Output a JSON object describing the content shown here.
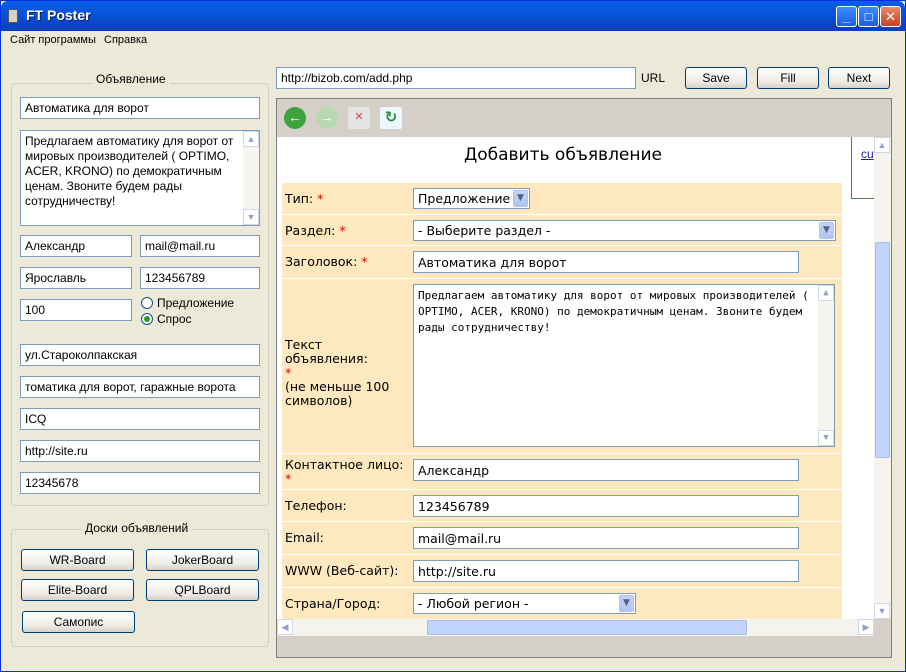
{
  "window": {
    "title": "FT Poster"
  },
  "menu": {
    "items": [
      "Сайт программы",
      "Справка"
    ]
  },
  "ad_panel": {
    "legend": "Объявление",
    "title": "Автоматика для ворот",
    "text": "Предлагаем автоматику для ворот от мировых производителей ( OPTIMO, ACER, KRONO) по демократичным ценам. Звоните будем рады сотрудничеству!",
    "name": "Александр",
    "email": "mail@mail.ru",
    "city": "Ярославль",
    "phone": "123456789",
    "price": "100",
    "radio_offer": "Предложение",
    "radio_demand": "Спрос",
    "address": "ул.Староколпакская",
    "keywords": "томатика для ворот, гаражные ворота",
    "icq": "ICQ",
    "site": "http://site.ru",
    "extra": "12345678"
  },
  "boards_panel": {
    "legend": "Доски объявлений",
    "buttons": [
      "WR-Board",
      "JokerBoard",
      "Elite-Board",
      "QPLBoard",
      "Самопис"
    ]
  },
  "urlbar": {
    "value": "http://bizob.com/add.php",
    "label": "URL",
    "save": "Save",
    "fill": "Fill",
    "next": "Next"
  },
  "form": {
    "title": "Добавить объявление",
    "type_label": "Тип:",
    "type_value": "Предложение",
    "section_label": "Раздел:",
    "section_value": "- Выберите раздел -",
    "heading_label": "Заголовок:",
    "heading_value": "Автоматика для ворот",
    "text_label": "Текст объявления:",
    "text_note": "(не меньше 100 символов)",
    "text_value": "Предлагаем автоматику для ворот от мировых производителей ( OPTIMO, ACER, KRONO) по демократичным ценам. Звоните будем рады сотрудничеству!",
    "contact_label": "Контактное лицо:",
    "contact_value": "Александр",
    "phone_label": "Телефон:",
    "phone_value": "123456789",
    "email_label": "Email:",
    "email_value": "mail@mail.ru",
    "www_label": "WWW (Веб-сайт):",
    "www_value": "http://site.ru",
    "country_label": "Страна/Город:",
    "country_value": "- Любой регион -",
    "required_mark": "*"
  },
  "side_link": "cu",
  "icons": [
    "back-arrow-icon",
    "forward-arrow-icon",
    "stop-icon",
    "refresh-icon"
  ]
}
